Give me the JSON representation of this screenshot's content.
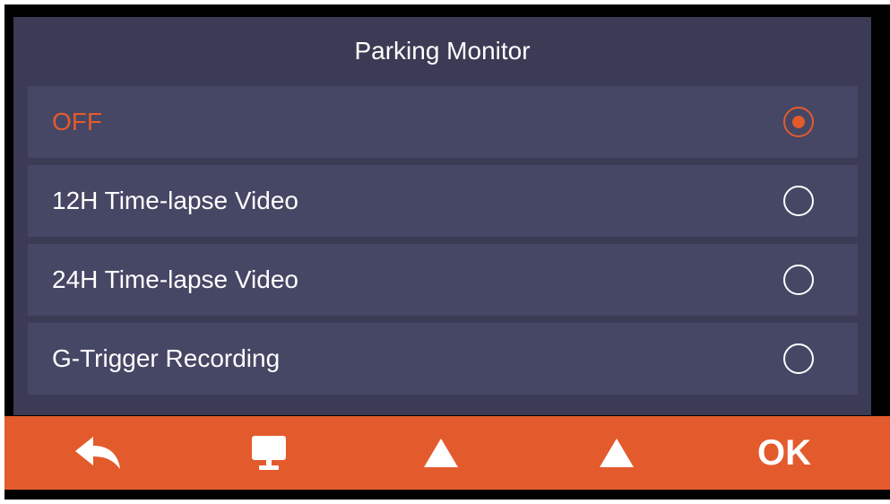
{
  "screen": {
    "title": "Parking Monitor"
  },
  "options": [
    {
      "label": "OFF",
      "selected": true
    },
    {
      "label": "12H Time-lapse Video",
      "selected": false
    },
    {
      "label": "24H Time-lapse Video",
      "selected": false
    },
    {
      "label": "G-Trigger Recording",
      "selected": false
    }
  ],
  "toolbar": {
    "back_icon": "back-arrow-icon",
    "menu_icon": "monitor-icon",
    "up_icon": "triangle-up-icon",
    "down_icon": "triangle-up-icon",
    "ok_label": "OK"
  },
  "colors": {
    "accent": "#e35b2c",
    "screen_bg": "#3b3b55",
    "row_bg": "#464665",
    "text": "#ffffff"
  }
}
